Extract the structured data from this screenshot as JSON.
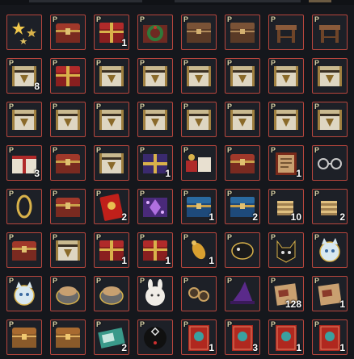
{
  "colors": {
    "slot_border": "#b8463d",
    "background": "#15171c"
  },
  "inventory": {
    "rows": [
      [
        {
          "icon": "stars-icon",
          "p": "",
          "count": ""
        },
        {
          "icon": "red-treasure-chest-icon",
          "p": "P",
          "count": ""
        },
        {
          "icon": "red-gift-chest-icon",
          "p": "P",
          "count": "1"
        },
        {
          "icon": "christmas-wreath-box-icon",
          "p": "P",
          "count": ""
        },
        {
          "icon": "brown-chest-icon",
          "p": "P",
          "count": ""
        },
        {
          "icon": "brown-chest-icon",
          "p": "P",
          "count": ""
        },
        {
          "icon": "wooden-stool-icon",
          "p": "P",
          "count": ""
        },
        {
          "icon": "wooden-stool-icon",
          "p": "P",
          "count": ""
        }
      ],
      [
        {
          "icon": "gold-crest-chest-icon",
          "p": "P",
          "count": "8"
        },
        {
          "icon": "red-gift-chest-icon",
          "p": "P",
          "count": ""
        },
        {
          "icon": "gold-crest-chest-icon",
          "p": "P",
          "count": ""
        },
        {
          "icon": "gold-crest-chest-icon",
          "p": "P",
          "count": ""
        },
        {
          "icon": "gold-crest-chest-icon",
          "p": "P",
          "count": ""
        },
        {
          "icon": "gold-crest-chest-icon",
          "p": "P",
          "count": ""
        },
        {
          "icon": "gold-crest-chest-icon",
          "p": "P",
          "count": ""
        },
        {
          "icon": "gold-crest-chest-icon",
          "p": "P",
          "count": ""
        }
      ],
      [
        {
          "icon": "gold-crest-chest-icon",
          "p": "P",
          "count": ""
        },
        {
          "icon": "gold-crest-chest-icon",
          "p": "P",
          "count": ""
        },
        {
          "icon": "gold-crest-chest-icon",
          "p": "P",
          "count": ""
        },
        {
          "icon": "gold-crest-chest-icon",
          "p": "P",
          "count": ""
        },
        {
          "icon": "gold-crest-chest-icon",
          "p": "P",
          "count": ""
        },
        {
          "icon": "gold-crest-chest-icon",
          "p": "P",
          "count": ""
        },
        {
          "icon": "gold-crest-chest-icon",
          "p": "P",
          "count": ""
        },
        {
          "icon": "gold-crest-chest-icon",
          "p": "P",
          "count": ""
        }
      ],
      [
        {
          "icon": "gift-card-chest-icon",
          "p": "P",
          "count": "3"
        },
        {
          "icon": "red-treasure-chest-icon",
          "p": "P",
          "count": ""
        },
        {
          "icon": "gold-crest-chest-icon",
          "p": "P",
          "count": ""
        },
        {
          "icon": "purple-gift-box-icon",
          "p": "P",
          "count": "1"
        },
        {
          "icon": "gift-bundle-icon",
          "p": "P",
          "count": ""
        },
        {
          "icon": "red-treasure-chest-icon",
          "p": "P",
          "count": ""
        },
        {
          "icon": "scroll-book-icon",
          "p": "P",
          "count": "1"
        },
        {
          "icon": "glasses-icon",
          "p": "P",
          "count": ""
        }
      ],
      [
        {
          "icon": "gold-ring-icon",
          "p": "P",
          "count": ""
        },
        {
          "icon": "red-treasure-chest-icon",
          "p": "P",
          "count": ""
        },
        {
          "icon": "red-envelope-icon",
          "p": "P",
          "count": "2"
        },
        {
          "icon": "purple-crystal-box-icon",
          "p": "P",
          "count": ""
        },
        {
          "icon": "blue-chest-icon",
          "p": "P",
          "count": "1"
        },
        {
          "icon": "blue-chest-icon",
          "p": "P",
          "count": "2"
        },
        {
          "icon": "coin-stack-icon",
          "p": "P",
          "count": "10"
        },
        {
          "icon": "coin-stack-icon",
          "p": "P",
          "count": "2"
        }
      ],
      [
        {
          "icon": "red-treasure-chest-icon",
          "p": "P",
          "count": ""
        },
        {
          "icon": "gold-crest-chest-icon",
          "p": "P",
          "count": ""
        },
        {
          "icon": "red-gift-chest-icon",
          "p": "P",
          "count": "1"
        },
        {
          "icon": "red-gift-chest-icon",
          "p": "P",
          "count": "1"
        },
        {
          "icon": "golden-charm-icon",
          "p": "P",
          "count": "1"
        },
        {
          "icon": "black-creature-icon",
          "p": "P",
          "count": ""
        },
        {
          "icon": "black-cat-icon",
          "p": "P",
          "count": ""
        },
        {
          "icon": "cat-face-icon",
          "p": "P",
          "count": ""
        }
      ],
      [
        {
          "icon": "cat-face-icon",
          "p": "P",
          "count": ""
        },
        {
          "icon": "fluffy-creature-icon",
          "p": "P",
          "count": ""
        },
        {
          "icon": "fluffy-creature-icon",
          "p": "P",
          "count": ""
        },
        {
          "icon": "white-bunny-icon",
          "p": "P",
          "count": ""
        },
        {
          "icon": "goggles-icon",
          "p": "P",
          "count": ""
        },
        {
          "icon": "witch-hat-icon",
          "p": "P",
          "count": ""
        },
        {
          "icon": "scroll-map-icon",
          "p": "P",
          "count": "128"
        },
        {
          "icon": "scroll-map-icon",
          "p": "P",
          "count": "1"
        }
      ],
      [
        {
          "icon": "wooden-chest-icon",
          "p": "P",
          "count": ""
        },
        {
          "icon": "wooden-chest-icon",
          "p": "P",
          "count": ""
        },
        {
          "icon": "ticket-card-icon",
          "p": "P",
          "count": "2"
        },
        {
          "icon": "round-token-icon",
          "p": "P",
          "count": ""
        },
        {
          "icon": "red-banner-icon",
          "p": "P",
          "count": "1"
        },
        {
          "icon": "red-banner-icon",
          "p": "P",
          "count": "3"
        },
        {
          "icon": "red-banner-icon",
          "p": "P",
          "count": "1"
        },
        {
          "icon": "red-banner-icon",
          "p": "P",
          "count": "1"
        }
      ]
    ]
  }
}
